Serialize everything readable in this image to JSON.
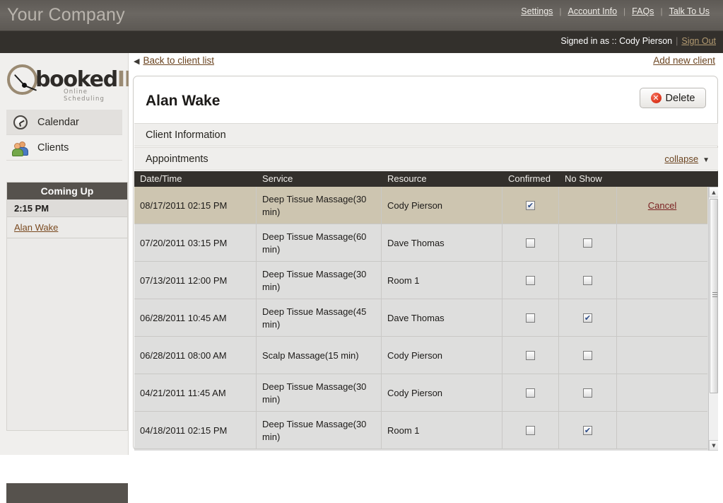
{
  "header": {
    "company": "Your Company",
    "nav": [
      {
        "label": "Settings"
      },
      {
        "label": "Account Info"
      },
      {
        "label": "FAQs"
      },
      {
        "label": "Talk To Us"
      }
    ],
    "separator": "|",
    "signed_in_prefix": "Signed in as :: ",
    "signed_in_user": "Cody Pierson",
    "sign_out": "Sign Out"
  },
  "brand": {
    "name_dark": "booked",
    "name_accent": "IN",
    "tagline": "Online Scheduling"
  },
  "sidebar": {
    "items": [
      {
        "label": "Calendar",
        "icon": "clock-icon",
        "active": true
      },
      {
        "label": "Clients",
        "icon": "people-icon",
        "active": false
      }
    ],
    "coming_up": {
      "title": "Coming Up",
      "time": "2:15 PM",
      "client": "Alan Wake"
    }
  },
  "crumb": {
    "back_arrow": "◀",
    "back_label": "Back to client list",
    "add_label": "Add new client"
  },
  "panel": {
    "client_name": "Alan Wake",
    "delete_label": "Delete",
    "delete_icon": "close-circle-icon",
    "sections": {
      "client_information": "Client Information",
      "appointments": "Appointments",
      "collapse_label": "collapse",
      "collapse_caret": "▼"
    }
  },
  "table": {
    "columns": [
      "Date/Time",
      "Service",
      "Resource",
      "Confirmed",
      "No Show"
    ],
    "cancel_label": "Cancel",
    "check_glyph": "✔",
    "rows": [
      {
        "datetime": "08/17/2011 02:15 PM",
        "service": "Deep Tissue Massage(30 min)",
        "resource": "Cody Pierson",
        "confirmed": true,
        "no_show": false,
        "no_show_visible": false,
        "action": "Cancel",
        "selected": true
      },
      {
        "datetime": "07/20/2011 03:15 PM",
        "service": "Deep Tissue Massage(60 min)",
        "resource": "Dave Thomas",
        "confirmed": false,
        "no_show": false,
        "no_show_visible": true,
        "action": "",
        "selected": false
      },
      {
        "datetime": "07/13/2011 12:00 PM",
        "service": "Deep Tissue Massage(30 min)",
        "resource": "Room 1",
        "confirmed": false,
        "no_show": false,
        "no_show_visible": true,
        "action": "",
        "selected": false
      },
      {
        "datetime": "06/28/2011 10:45 AM",
        "service": "Deep Tissue Massage(45 min)",
        "resource": "Dave Thomas",
        "confirmed": false,
        "no_show": true,
        "no_show_visible": true,
        "action": "",
        "selected": false
      },
      {
        "datetime": "06/28/2011 08:00 AM",
        "service": "Scalp Massage(15 min)",
        "resource": "Cody Pierson",
        "confirmed": false,
        "no_show": false,
        "no_show_visible": true,
        "action": "",
        "selected": false
      },
      {
        "datetime": "04/21/2011 11:45 AM",
        "service": "Deep Tissue Massage(30 min)",
        "resource": "Cody Pierson",
        "confirmed": false,
        "no_show": false,
        "no_show_visible": true,
        "action": "",
        "selected": false
      },
      {
        "datetime": "04/18/2011 02:15 PM",
        "service": "Deep Tissue Massage(30 min)",
        "resource": "Room 1",
        "confirmed": false,
        "no_show": true,
        "no_show_visible": true,
        "action": "",
        "selected": false
      }
    ]
  },
  "scrollbar": {
    "up_glyph": "▲",
    "down_glyph": "▼"
  },
  "colors": {
    "topbar": "#6b6762",
    "signed_bar": "#33302c",
    "accent_link": "#6b4420",
    "selected_row": "#cdc5b0",
    "table_header": "#33302c",
    "brand_accent": "#9a8a72",
    "delete_red": "#e03b22"
  }
}
